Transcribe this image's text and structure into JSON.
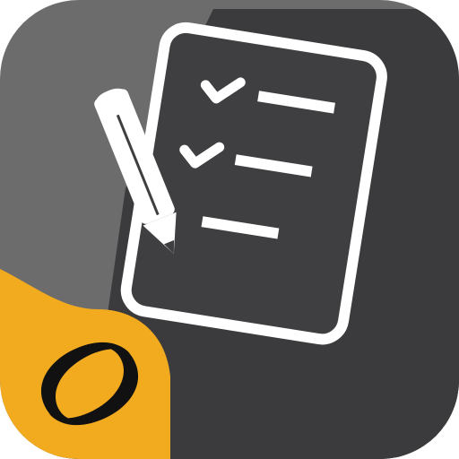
{
  "icon": {
    "name": "checklist-app-icon",
    "glyphs": [
      "clipboard-icon",
      "pencil-icon",
      "check-icon",
      "brand-logo-icon"
    ],
    "colors": {
      "background": "#6d6c6d",
      "shadow": "#3b3a3c",
      "clipboard_fill": "#3f3e40",
      "stroke": "#ffffff",
      "accent": "#f2aa1f",
      "logo": "#111111"
    },
    "checklist": {
      "items": [
        {
          "checked": true
        },
        {
          "checked": true
        },
        {
          "checked": false
        }
      ]
    }
  }
}
